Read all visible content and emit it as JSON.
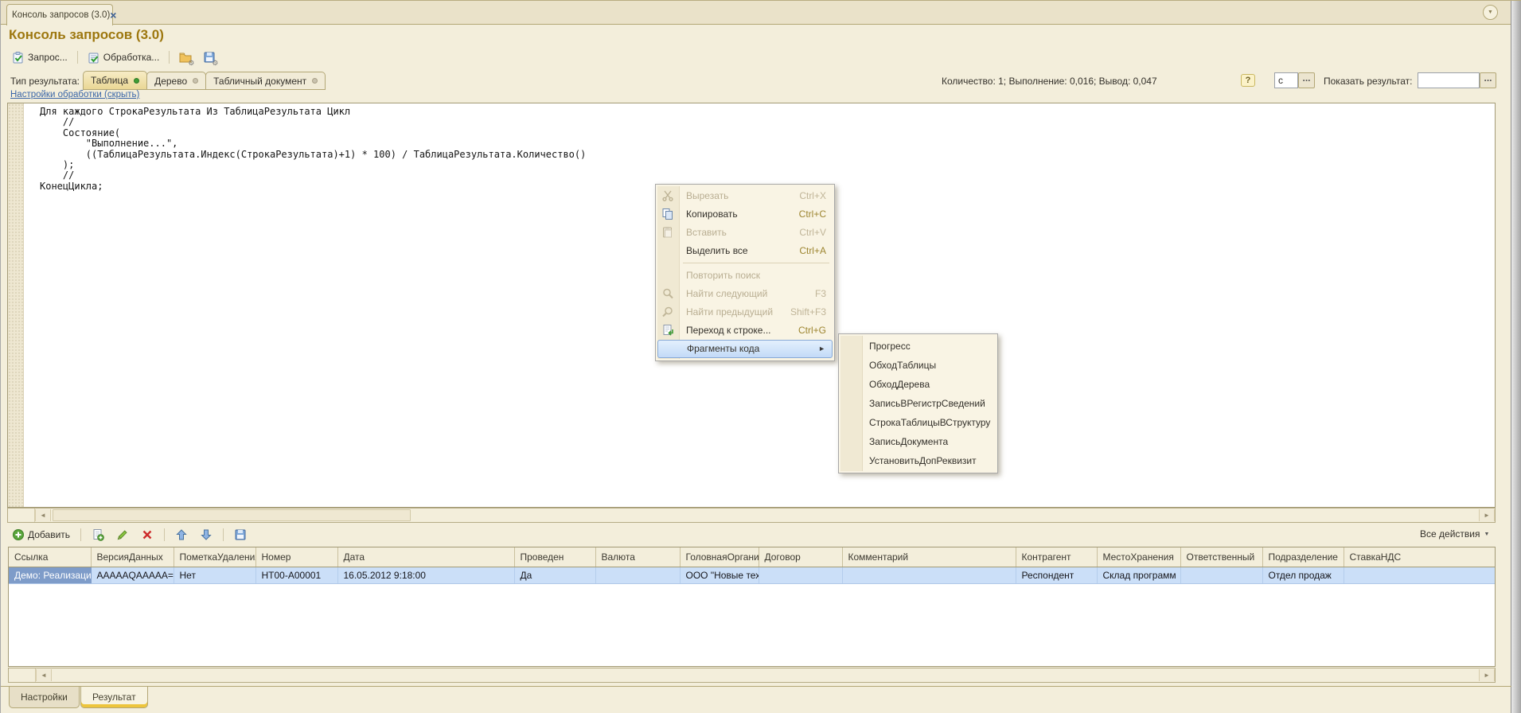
{
  "window": {
    "tab_title": "Консоль запросов (3.0)",
    "page_title": "Консоль запросов (3.0)"
  },
  "icons": {
    "close": "×",
    "chevron_down": "▼",
    "gear": "⚙",
    "submenu_arrow": "►",
    "scroll_left": "◄",
    "scroll_right": "►",
    "dropdown_arrow": "▼"
  },
  "labels": {
    "ellipsis": "..."
  },
  "toolbar": {
    "query_label": "Запрос...",
    "processing_label": "Обработка..."
  },
  "result_type": {
    "label": "Тип результата:",
    "options": [
      {
        "label": "Таблица",
        "selected": true
      },
      {
        "label": "Дерево",
        "selected": false
      },
      {
        "label": "Табличный документ",
        "selected": false
      }
    ]
  },
  "stats": {
    "summary": "Количество: 1; Выполнение: 0,016; Вывод: 0,047",
    "help_label": "?",
    "seconds_value": "с",
    "show_result_label": "Показать результат:",
    "show_result_value": ""
  },
  "settings_link": "Настройки обработки (скрыть)",
  "code_editor": {
    "lines": [
      "Для каждого СтрокаРезультата Из ТаблицаРезультата Цикл",
      "    //",
      "    Состояние(",
      "        \"Выполнение...\",",
      "        ((ТаблицаРезультата.Индекс(СтрокаРезультата)+1) * 100) / ТаблицаРезультата.Количество()",
      "    );",
      "    //",
      "КонецЦикла;"
    ]
  },
  "context_menu": {
    "items": [
      {
        "label": "Вырезать",
        "shortcut": "Ctrl+X",
        "disabled": true
      },
      {
        "label": "Копировать",
        "shortcut": "Ctrl+C",
        "disabled": false
      },
      {
        "label": "Вставить",
        "shortcut": "Ctrl+V",
        "disabled": true
      },
      {
        "label": "Выделить все",
        "shortcut": "Ctrl+A",
        "disabled": false
      },
      {
        "label": "Повторить поиск",
        "shortcut": "",
        "disabled": true
      },
      {
        "label": "Найти следующий",
        "shortcut": "F3",
        "disabled": true
      },
      {
        "label": "Найти предыдущий",
        "shortcut": "Shift+F3",
        "disabled": true
      },
      {
        "label": "Переход к строке...",
        "shortcut": "Ctrl+G",
        "disabled": false
      },
      {
        "label": "Фрагменты кода",
        "shortcut": "",
        "disabled": false,
        "highlighted": true
      }
    ]
  },
  "submenu": {
    "items": [
      "Прогресс",
      "ОбходТаблицы",
      "ОбходДерева",
      "ЗаписьВРегистрСведений",
      "СтрокаТаблицыВСтруктуру",
      "ЗаписьДокумента",
      "УстановитьДопРеквизит"
    ]
  },
  "table_toolbar": {
    "add_label": "Добавить",
    "all_actions_label": "Все действия"
  },
  "result_table": {
    "columns": [
      "Ссылка",
      "ВерсияДанных",
      "ПометкаУдаления",
      "Номер",
      "Дата",
      "Проведен",
      "Валюта",
      "ГоловнаяОрганизация",
      "Договор",
      "Комментарий",
      "Контрагент",
      "МестоХранения",
      "Ответственный",
      "Подразделение",
      "СтавкаНДС"
    ],
    "rows": [
      [
        "Демо: Реализация т...",
        "AAAAAQAAAAA=",
        "Нет",
        "НТ00-А00001",
        "16.05.2012 9:18:00",
        "Да",
        "",
        "ООО \"Новые технол...",
        "",
        "",
        "Респондент",
        "Склад программ",
        "",
        "Отдел продаж",
        ""
      ]
    ]
  },
  "bottom_tabs": [
    {
      "label": "Настройки",
      "active": false
    },
    {
      "label": "Результат",
      "active": true
    }
  ],
  "colors": {
    "title": "#9d770e",
    "link": "#3a66a8",
    "selected_row": "#cbdff8",
    "focused_cell": "#7e9cc9",
    "menu_highlight_border": "#87a9d6",
    "active_tab_underline": "#edc53c",
    "green_indicator": "#3f9c35"
  }
}
